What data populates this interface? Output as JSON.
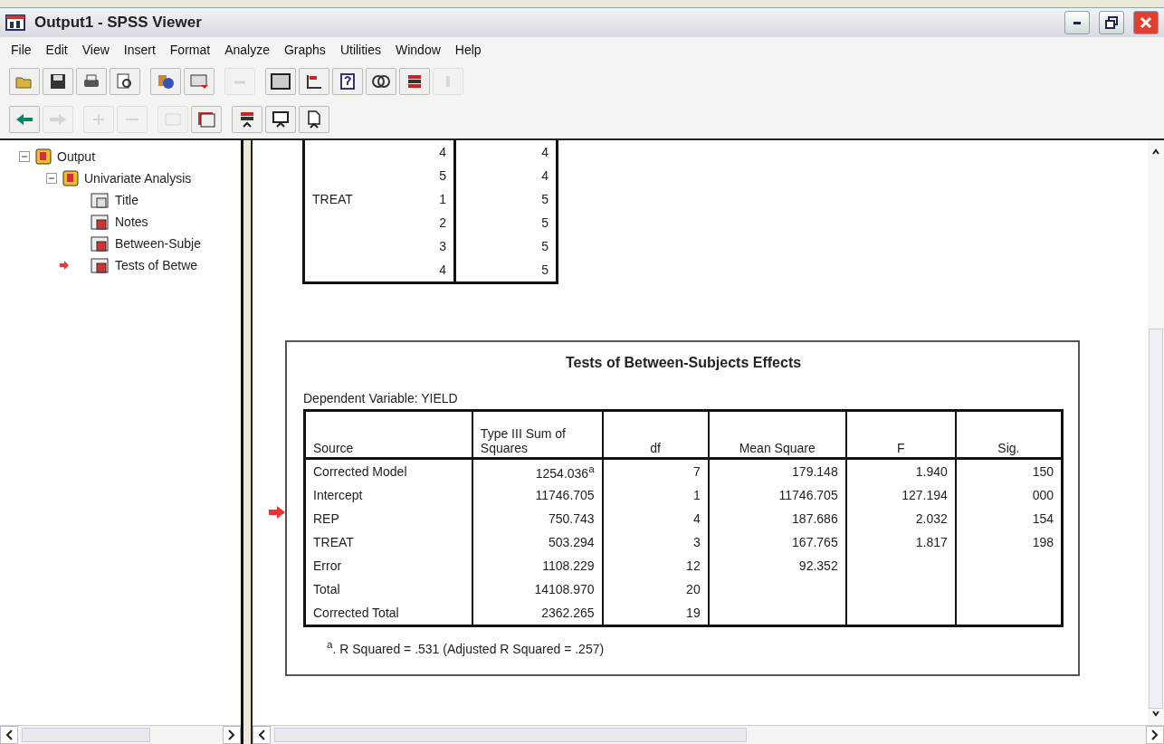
{
  "window": {
    "title": "Output1 - SPSS Viewer"
  },
  "menu": [
    "File",
    "Edit",
    "View",
    "Insert",
    "Format",
    "Analyze",
    "Graphs",
    "Utilities",
    "Window",
    "Help"
  ],
  "toolbar_1": [
    {
      "disabled": false
    },
    {
      "disabled": false
    },
    {
      "disabled": false
    },
    {
      "disabled": false
    },
    {
      "disabled": false
    },
    {
      "disabled": false
    },
    {
      "disabled": true
    },
    {
      "disabled": false
    },
    {
      "disabled": false
    },
    {
      "disabled": false
    },
    {
      "disabled": false
    },
    {
      "disabled": false
    },
    {
      "disabled": true
    }
  ],
  "toolbar_2": [
    {
      "disabled": false
    },
    {
      "disabled": true
    },
    {
      "disabled": true
    },
    {
      "disabled": true
    },
    {
      "disabled": true
    },
    {
      "disabled": false
    },
    {
      "disabled": false
    },
    {
      "disabled": false
    },
    {
      "disabled": false
    }
  ],
  "outline": [
    {
      "label": "Output",
      "current": false,
      "children": [
        {
          "label": "Univariate Analysis",
          "current": false,
          "children": [
            {
              "label": "Title",
              "current": false
            },
            {
              "label": "Notes",
              "current": false
            },
            {
              "label": "Between-Subje",
              "current": false
            },
            {
              "label": "Tests of Betwe",
              "current": true
            }
          ]
        }
      ]
    }
  ],
  "factors_table": {
    "rows": [
      {
        "column_1": "",
        "column_2": "4",
        "column_3": "4"
      },
      {
        "column_1": "",
        "column_2": "5",
        "column_3": "4"
      },
      {
        "column_1": "TREAT",
        "column_2": "1",
        "column_3": "5"
      },
      {
        "column_1": "",
        "column_2": "2",
        "column_3": "5"
      },
      {
        "column_1": "",
        "column_2": "3",
        "column_3": "5"
      },
      {
        "column_1": "",
        "column_2": "4",
        "column_3": "5"
      }
    ]
  },
  "effects_table": {
    "title": "Tests of Between-Subjects Effects",
    "subtitle": "Dependent Variable: YIELD",
    "current": true,
    "columns": [
      "Source",
      "Type III Sum of Squares",
      "df",
      "Mean Square",
      "F",
      "Sig."
    ],
    "rows": [
      [
        "Corrected Model",
        "1254.036$^{a}$",
        "7",
        "179.148",
        "1.940",
        "150"
      ],
      [
        "Intercept",
        "11746.705",
        "1",
        "11746.705",
        "127.194",
        "000"
      ],
      [
        "REP",
        "750.743",
        "4",
        "187.686",
        "2.032",
        "154"
      ],
      [
        "TREAT",
        "503.294",
        "3",
        "167.765",
        "1.817",
        "198"
      ],
      [
        "Error",
        "1108.229",
        "12",
        "92.352",
        "",
        ""
      ],
      [
        "Total",
        "14108.970",
        "20",
        "",
        "",
        ""
      ],
      [
        "Corrected Total",
        "2362.265",
        "19",
        "",
        "",
        ""
      ]
    ],
    "footnote": "$^{a}$. R Squared = .531 (Adjusted R Squared = .257)"
  }
}
